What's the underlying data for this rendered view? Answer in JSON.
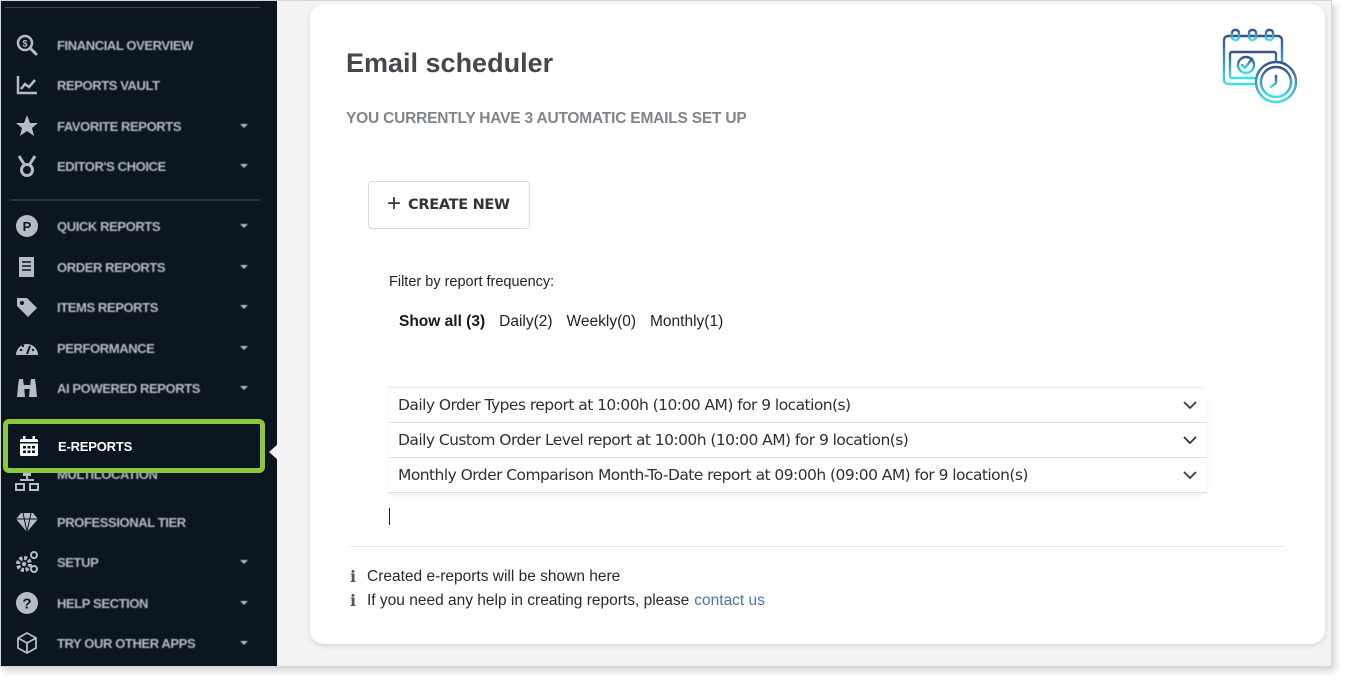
{
  "sidebar": {
    "items": [
      {
        "label": "FINANCIAL OVERVIEW",
        "icon": "search-dollar-icon",
        "has_caret": false
      },
      {
        "label": "REPORTS VAULT",
        "icon": "chart-line-icon",
        "has_caret": false
      },
      {
        "label": "FAVORITE REPORTS",
        "icon": "star-icon",
        "has_caret": true
      },
      {
        "label": "EDITOR'S CHOICE",
        "icon": "medal-icon",
        "has_caret": true
      },
      {
        "label": "QUICK REPORTS",
        "icon": "parking-circle-icon",
        "has_caret": true
      },
      {
        "label": "ORDER REPORTS",
        "icon": "receipt-icon",
        "has_caret": true
      },
      {
        "label": "ITEMS REPORTS",
        "icon": "tag-icon",
        "has_caret": true
      },
      {
        "label": "PERFORMANCE",
        "icon": "speedometer-icon",
        "has_caret": true
      },
      {
        "label": "AI POWERED REPORTS",
        "icon": "binoculars-icon",
        "has_caret": true
      },
      {
        "label": "E-REPORTS",
        "icon": "calendar-icon",
        "has_caret": false,
        "active": true
      },
      {
        "label": "MULTILOCATION",
        "icon": "sitemap-icon",
        "has_caret": false
      },
      {
        "label": "PROFESSIONAL TIER",
        "icon": "diamond-icon",
        "has_caret": false
      },
      {
        "label": "SETUP",
        "icon": "gears-icon",
        "has_caret": true
      },
      {
        "label": "HELP SECTION",
        "icon": "question-circle-icon",
        "has_caret": true
      },
      {
        "label": "TRY OUR OTHER APPS",
        "icon": "cube-icon",
        "has_caret": true
      }
    ]
  },
  "main": {
    "title": "Email scheduler",
    "subtitle": "YOU CURRENTLY HAVE 3 AUTOMATIC EMAILS SET UP",
    "hero_icon": "calendar-clock-icon",
    "create_button": {
      "icon": "plus-icon",
      "label": "CREATE NEW"
    },
    "filter": {
      "label": "Filter by report frequency:",
      "options": [
        {
          "label": "Show all (3)",
          "active": true
        },
        {
          "label": "Daily(2)",
          "active": false
        },
        {
          "label": "Weekly(0)",
          "active": false
        },
        {
          "label": "Monthly(1)",
          "active": false
        }
      ]
    },
    "reports": [
      {
        "text": "Daily Order Types report at 10:00h (10:00 AM) for 9 location(s)"
      },
      {
        "text": "Daily Custom Order Level report at 10:00h (10:00 AM) for 9 location(s)"
      },
      {
        "text": "Monthly Order Comparison Month-To-Date report at 09:00h (09:00 AM) for 9 location(s)"
      }
    ],
    "info": {
      "line1": "Created e-reports will be shown here",
      "line2": "If you need any help in creating reports, please",
      "link": "contact us"
    }
  },
  "colors": {
    "sidebar_bg": "#0b1621",
    "active_outline": "#8dc63f",
    "link": "#4a74a6",
    "icon_gradient_top": "#3a4f8c",
    "icon_gradient_bottom": "#3fe0f0"
  }
}
